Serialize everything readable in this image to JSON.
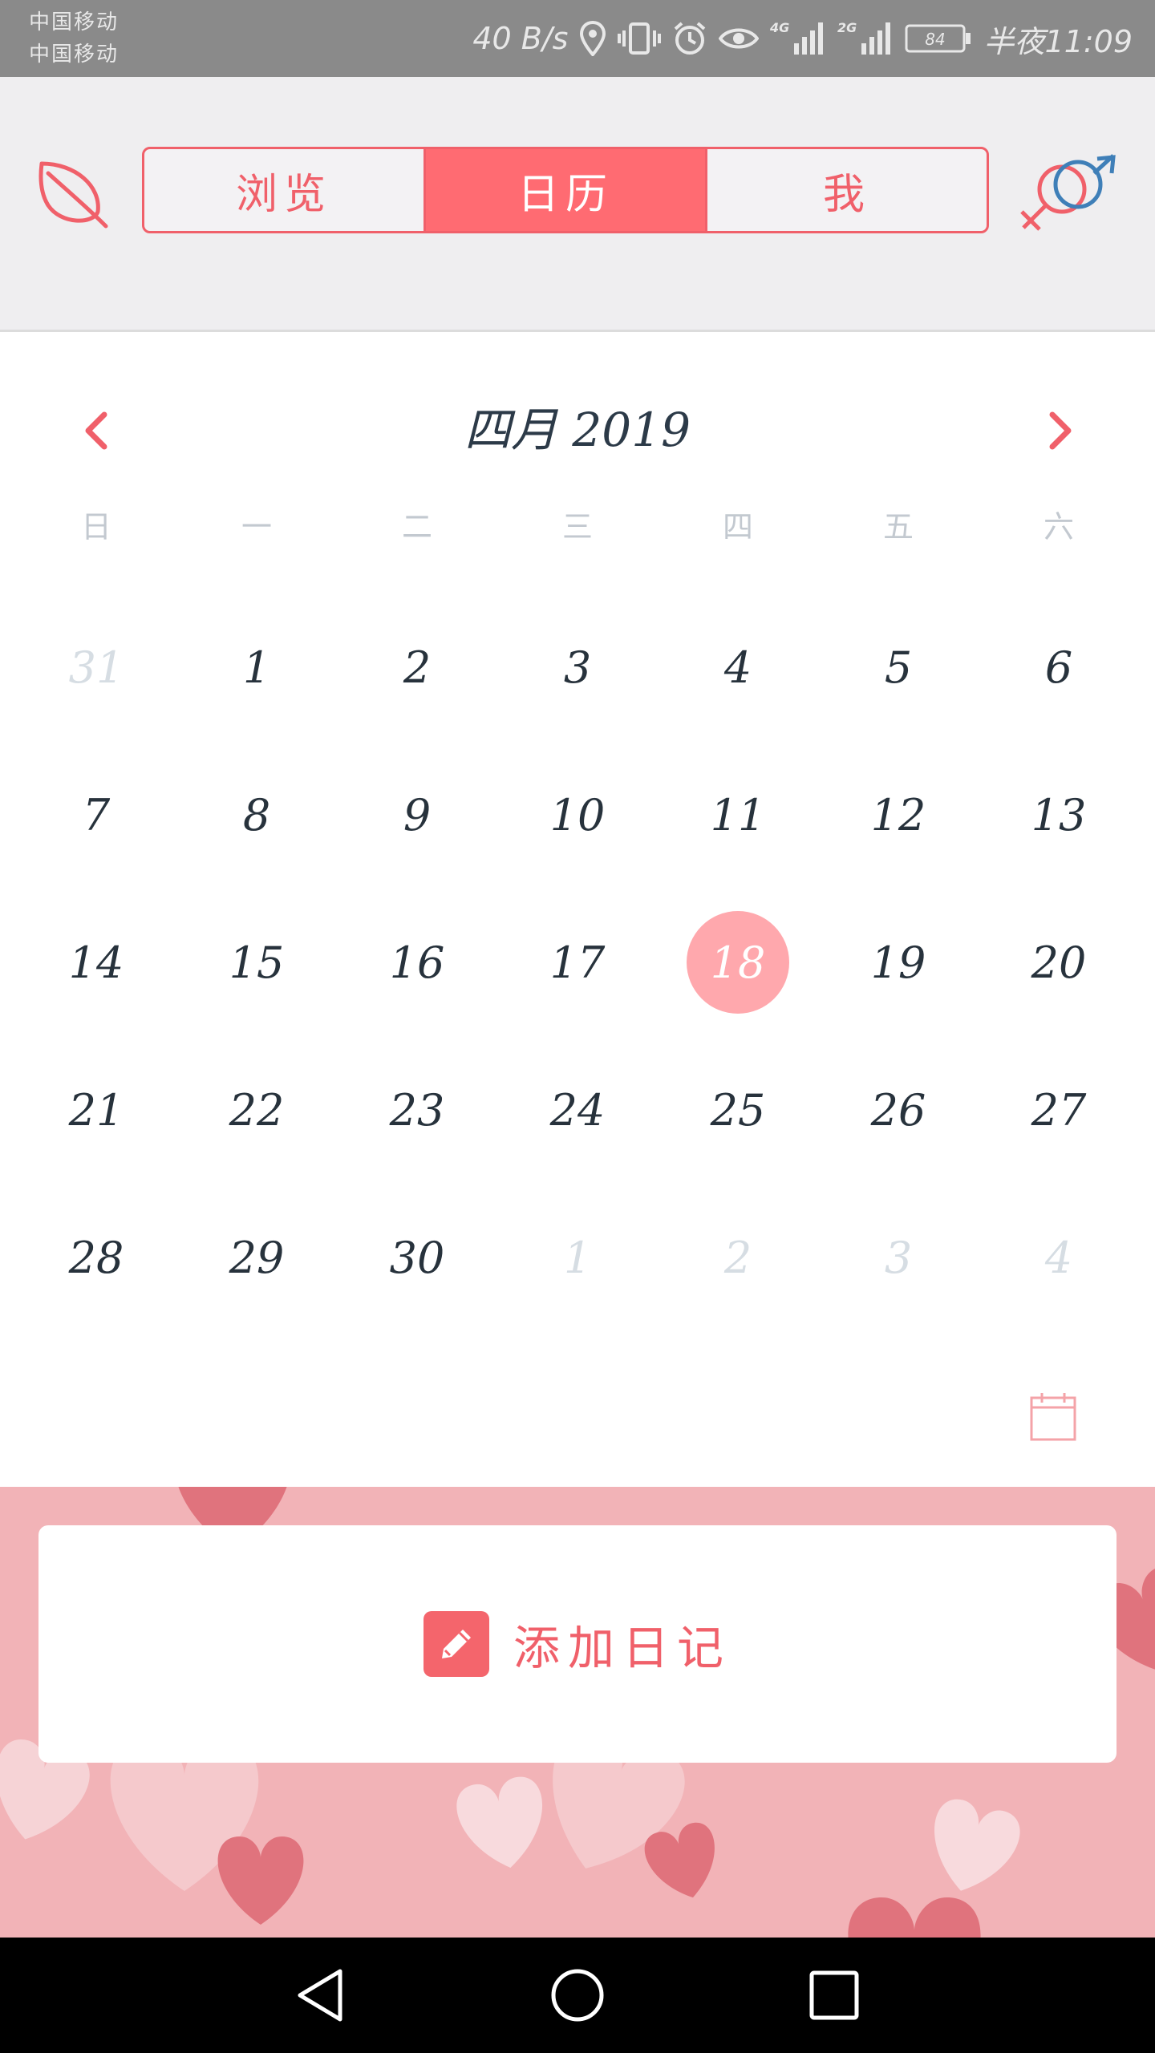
{
  "status_bar": {
    "carrier1": "中国移动",
    "carrier2": "中国移动",
    "speed": "40 B/s",
    "net1": "4G",
    "net2": "2G",
    "battery": "84",
    "time": "半夜11:09"
  },
  "header": {
    "tabs": [
      "浏览",
      "日历",
      "我"
    ],
    "active_tab": 1
  },
  "calendar": {
    "title": "四月 2019",
    "weekdays": [
      "日",
      "一",
      "二",
      "三",
      "四",
      "五",
      "六"
    ],
    "weeks": [
      [
        "31",
        "1",
        "2",
        "3",
        "4",
        "5",
        "6"
      ],
      [
        "7",
        "8",
        "9",
        "10",
        "11",
        "12",
        "13"
      ],
      [
        "14",
        "15",
        "16",
        "17",
        "18",
        "19",
        "20"
      ],
      [
        "21",
        "22",
        "23",
        "24",
        "25",
        "26",
        "27"
      ],
      [
        "28",
        "29",
        "30",
        "1",
        "2",
        "3",
        "4"
      ]
    ],
    "muted": [
      [
        0,
        0
      ],
      [
        4,
        3
      ],
      [
        4,
        4
      ],
      [
        4,
        5
      ],
      [
        4,
        6
      ]
    ],
    "selected": [
      2,
      4
    ]
  },
  "add_diary": {
    "label": "添加日记"
  },
  "colors": {
    "accent": "#f0606a",
    "active_tab": "#ff6b72",
    "selected_day": "#ffa8ad",
    "hearts_bg": "#f2b3b7"
  }
}
